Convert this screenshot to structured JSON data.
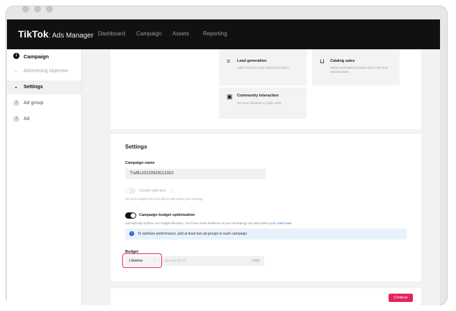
{
  "app": {
    "brand": "TikTok",
    "brand_sub": ": Ads Manager"
  },
  "nav": [
    "Dashboard",
    "Campaign",
    "Assets",
    "Reporting"
  ],
  "sidebar": {
    "steps": [
      {
        "number": "1",
        "label": "Campaign"
      },
      {
        "number": "",
        "label": "Advertising objective"
      },
      {
        "number": "",
        "label": "Settings"
      },
      {
        "number": "2",
        "label": "Ad group"
      },
      {
        "number": "3",
        "label": "Ad"
      }
    ]
  },
  "objectives": [
    {
      "title": "Lead generation",
      "desc": "Collect leads for your business or brand.",
      "icon": "funnel-icon"
    },
    {
      "title": "Catalog sales",
      "desc": "Deliver personalized product ads to the most relevant users.",
      "icon": "cart-icon"
    },
    {
      "title": "Community interaction",
      "desc": "Get more followers or profile visits.",
      "icon": "chat-icon"
    }
  ],
  "settings": {
    "title": "Settings",
    "campaign_name_label": "Campaign name",
    "campaign_name_value": "Traffic20220929113310",
    "split_test_label": "Create split test",
    "split_test_desc": "Get more insights into your ads by split testing your strategy.",
    "cbo_label": "Campaign budget optimization",
    "cbo_desc": "Automatically optimize your budget allocation. You'll have some limitations on your bid strategy and optimization goal.",
    "learn_more": "Learn more",
    "info_text": "To optimize performance, add at least two ad groups to each campaign.",
    "budget_label": "Budget",
    "budget_type": "Lifetime",
    "budget_placeholder": "At least 50.00",
    "currency": "USD"
  },
  "footer": {
    "continue_label": "Continue"
  },
  "colors": {
    "accent": "#e3265a",
    "topbar": "#111111",
    "info_bg": "#e9f1fc",
    "link": "#2b63d9"
  }
}
